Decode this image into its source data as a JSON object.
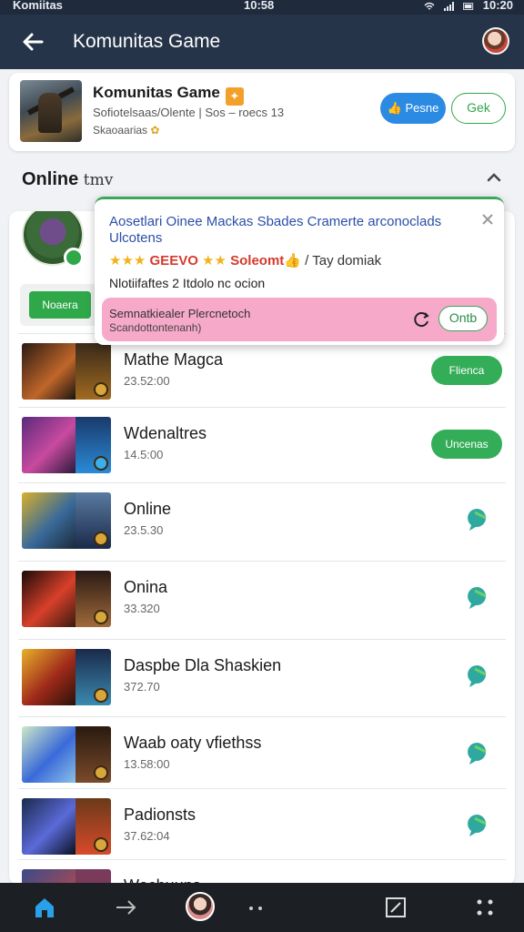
{
  "status_bar": {
    "left": "Komiitas",
    "time": "10:58",
    "right": "10:20"
  },
  "app_bar": {
    "title": "Komunitas Game"
  },
  "group": {
    "name": "Komunitas Game",
    "meta": "Sofiotelsaas/Olente | Sos – roecs 13",
    "sub": "Skaoaarias",
    "join_label": "Pesne",
    "chat_label": "Gek"
  },
  "section": {
    "title": "Online",
    "subtitle": "tmv"
  },
  "host": {
    "button_label": "Noaera"
  },
  "popup": {
    "line1": "Aosetlari Oinee Mackas Sbades Cramerte arconoclads Ulcotens",
    "stars_left": "★★★",
    "badge_text": "GEEVO",
    "stars_mid": "★★",
    "badge_text2": "Soleomt",
    "suffix": "/ Tay domiak",
    "line3": "Nlotiifaftes 2 Itdolo nc ocion",
    "alert_line1": "Semnatkiealer Plercnetoch",
    "alert_line2": "Scandottontenanh)",
    "alert_button": "Ontb"
  },
  "rows": [
    {
      "name": "Mathe Magca",
      "time": "23.52:00",
      "action": "Flienca"
    },
    {
      "name": "Wdenaltres",
      "time": "14.5:00",
      "action": "Uncenas"
    },
    {
      "name": "Online",
      "time": "23.5.30",
      "action": ""
    },
    {
      "name": "Onina",
      "time": "33.320",
      "action": ""
    },
    {
      "name": "Daspbe Dla Shaskien",
      "time": "372.70",
      "action": ""
    },
    {
      "name": "Waab oaty vfiethss",
      "time": "13.58:00",
      "action": ""
    },
    {
      "name": "Padionsts",
      "time": "37.62:04",
      "action": ""
    },
    {
      "name": "Wochuuns",
      "time": "",
      "action": ""
    }
  ],
  "colors": {
    "appbar": "#263449",
    "accent_green": "#34ad58",
    "accent_blue": "#2b8be3",
    "alert_pink": "#f6a9c8"
  }
}
